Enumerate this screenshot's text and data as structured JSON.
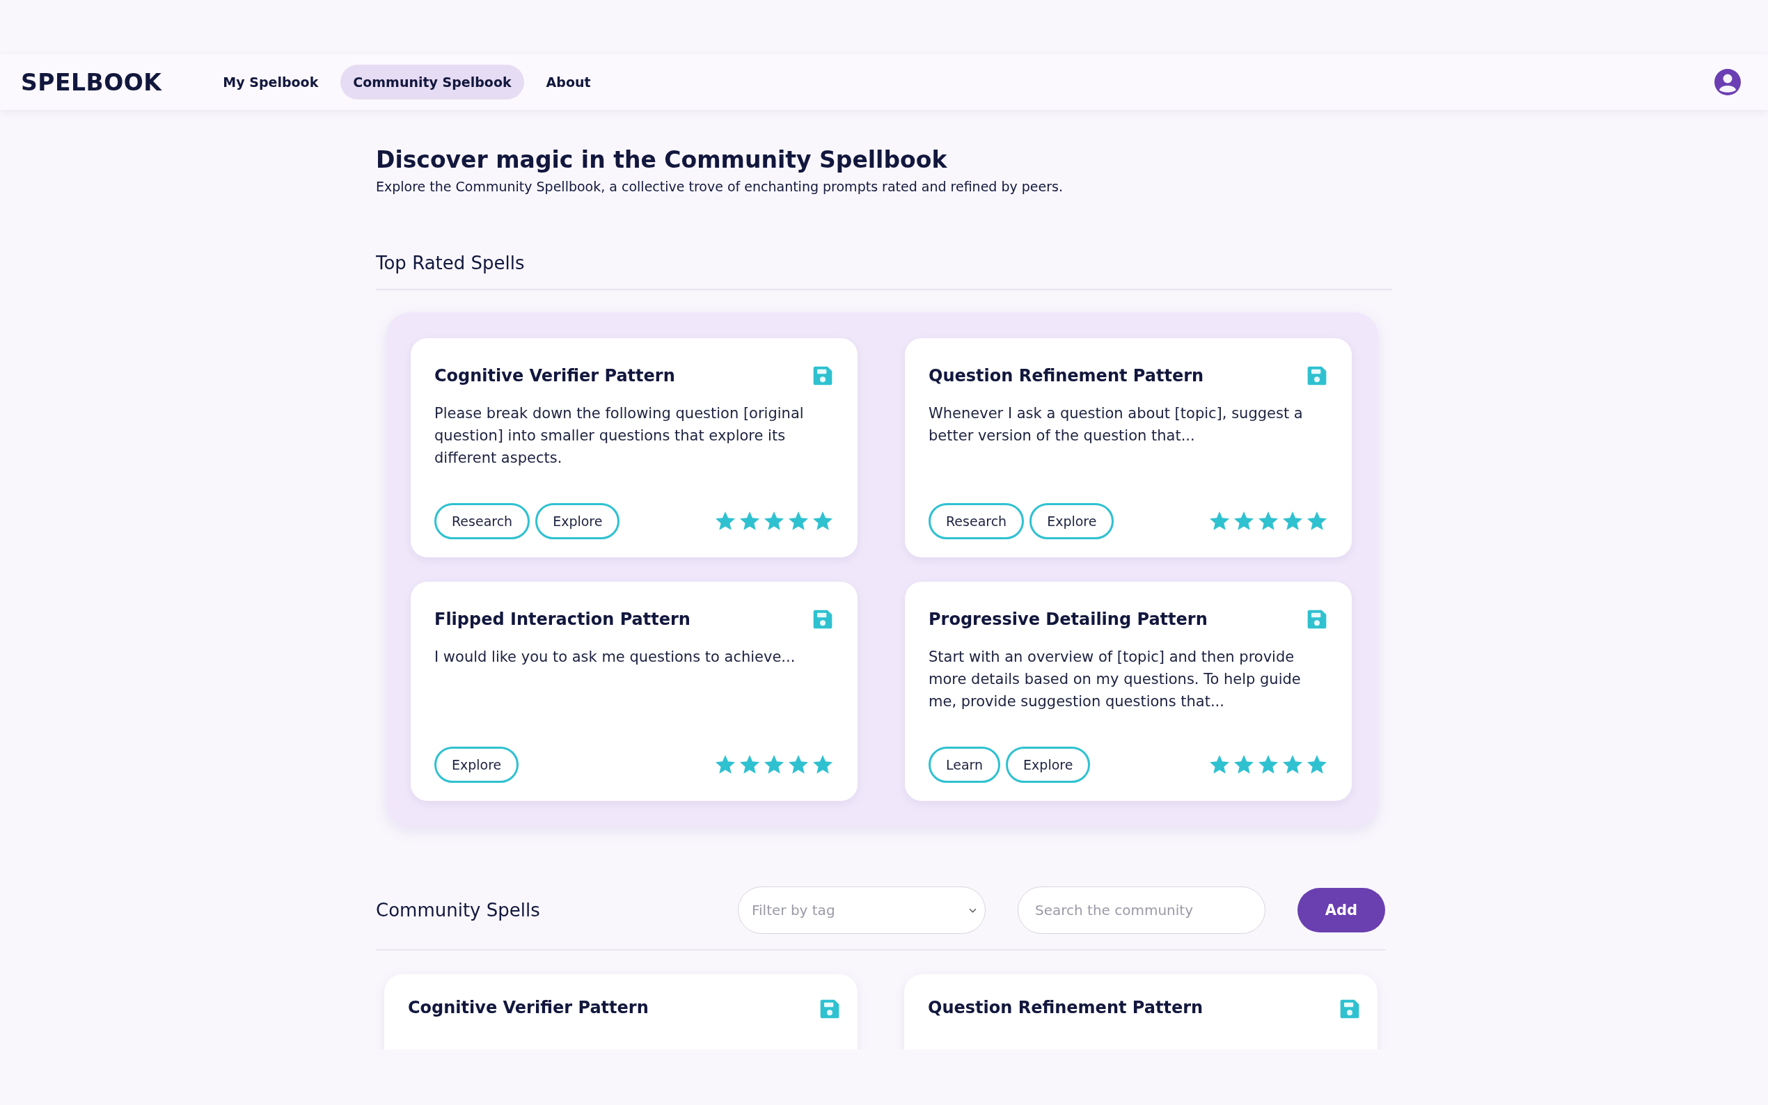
{
  "header": {
    "logo": "SPELBOOK",
    "nav": [
      {
        "label": "My Spelbook",
        "selected": false
      },
      {
        "label": "Community Spelbook",
        "selected": true
      },
      {
        "label": "About",
        "selected": false
      }
    ]
  },
  "intro": {
    "title": "Discover magic in the Community Spellbook",
    "subtitle": "Explore the Community Spellbook, a collective trove of enchanting prompts rated and refined by peers."
  },
  "top_rated": {
    "heading": "Top Rated Spells",
    "cards": [
      {
        "title": "Cognitive Verifier Pattern",
        "text": "Please break down the following question [original question] into smaller questions that explore its different aspects.",
        "tags": [
          "Research",
          "Explore"
        ],
        "stars": 5
      },
      {
        "title": "Question Refinement Pattern",
        "text": "Whenever I ask a question about [topic], suggest a better version of the question that...",
        "tags": [
          "Research",
          "Explore"
        ],
        "stars": 5
      },
      {
        "title": "Flipped Interaction Pattern",
        "text": "I would like you to ask me questions to achieve...",
        "tags": [
          "Explore"
        ],
        "stars": 5
      },
      {
        "title": "Progressive Detailing Pattern",
        "text": "Start with an overview of [topic] and then provide more details based on my questions. To help guide me, provide suggestion questions that...",
        "tags": [
          "Learn",
          "Explore"
        ],
        "stars": 5
      }
    ]
  },
  "community": {
    "heading": "Community Spells",
    "filter": {
      "placeholder": "Filter by tag"
    },
    "search": {
      "placeholder": "Search the community"
    },
    "add_button": "Add",
    "cards": [
      {
        "title": "Cognitive Verifier Pattern"
      },
      {
        "title": "Question Refinement Pattern"
      }
    ]
  }
}
